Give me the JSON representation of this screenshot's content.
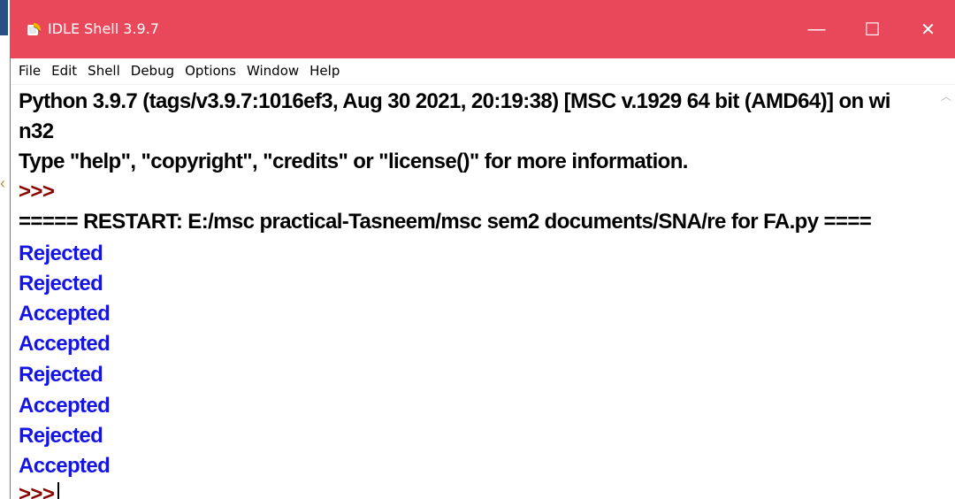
{
  "window": {
    "title": "IDLE Shell 3.9.7",
    "colors": {
      "titlebar": "#e8485a",
      "output_blue": "#1414e6",
      "prompt": "#8b0000"
    },
    "controls": {
      "minimize": "—",
      "maximize": "☐",
      "close": "✕"
    }
  },
  "menu": [
    "File",
    "Edit",
    "Shell",
    "Debug",
    "Options",
    "Window",
    "Help"
  ],
  "shell": {
    "banner_line1": "Python 3.9.7 (tags/v3.9.7:1016ef3, Aug 30 2021, 20:19:38) [MSC v.1929 64 bit (AMD64)] on wi",
    "banner_line2": "n32",
    "banner_line3": "Type \"help\", \"copyright\", \"credits\" or \"license()\" for more information.",
    "prompt": ">>>",
    "restart_line": "===== RESTART: E:/msc practical-Tasneem/msc sem2 documents/SNA/re for FA.py ====",
    "outputs": [
      "Rejected",
      "Rejected",
      "Accepted",
      "Accepted",
      "Rejected",
      "Accepted",
      "Rejected",
      "Accepted"
    ],
    "final_prompt": ">>>"
  },
  "icons": {
    "app": "python-feather-icon",
    "scroll_up": "chevron-up-icon"
  }
}
